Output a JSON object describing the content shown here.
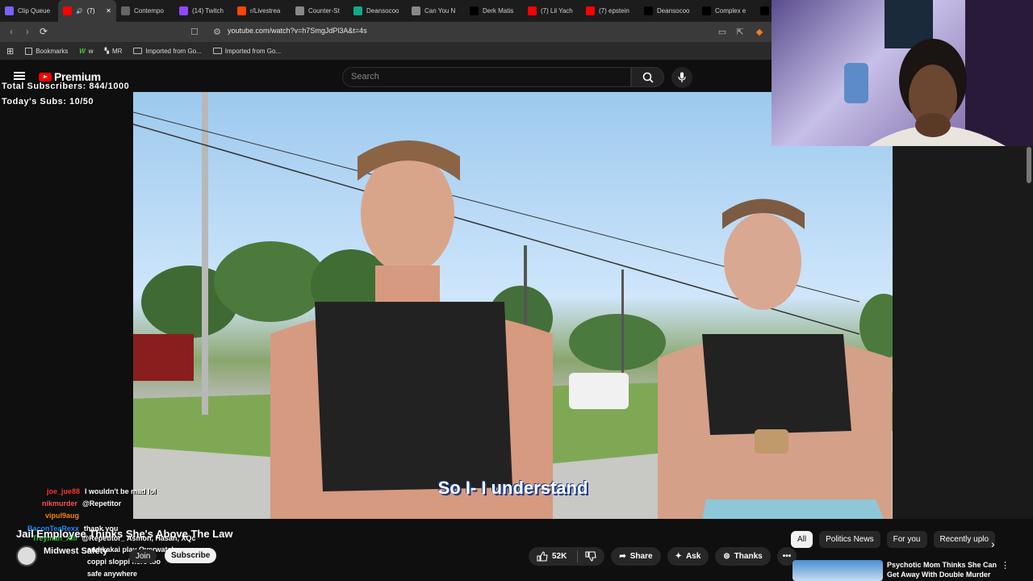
{
  "tabs": [
    {
      "label": "Clip Queue",
      "color": "#7b61ff"
    },
    {
      "label": "(7)",
      "color": "#ff0000",
      "active": true
    },
    {
      "label": "Contempo",
      "color": "#666"
    },
    {
      "label": "(14) Twitch",
      "color": "#9146ff"
    },
    {
      "label": "r/Livestrea",
      "color": "#ff4500"
    },
    {
      "label": "Counter-St",
      "color": "#888"
    },
    {
      "label": "Deansocoo",
      "color": "#1a8"
    },
    {
      "label": "Can You N",
      "color": "#888"
    },
    {
      "label": "Derk Matis",
      "color": "#000"
    },
    {
      "label": "(7) Lil Yach",
      "color": "#ff0000"
    },
    {
      "label": "(7) epstein",
      "color": "#ff0000"
    },
    {
      "label": "Deansocoo",
      "color": "#000"
    },
    {
      "label": "Complex e",
      "color": "#000"
    },
    {
      "label": "Sc",
      "color": "#000"
    }
  ],
  "address": {
    "url": "youtube.com/watch?v=h7SmgJdPl3A&t=4s"
  },
  "bookmarks": [
    {
      "label": "Bookmarks"
    },
    {
      "label": "w"
    },
    {
      "label": "MR"
    },
    {
      "label": "Imported from Go..."
    },
    {
      "label": "Imported from Go..."
    }
  ],
  "youtube": {
    "logo": "Premium",
    "search_placeholder": "Search"
  },
  "overlay": {
    "total_subs": "Total Subscribers: 844/1000",
    "today_subs": "Today's Subs: 10/50"
  },
  "video": {
    "subtitle": "So I- I understand"
  },
  "chat": [
    {
      "user": "joe_jue88",
      "msg": "I wouldn't be mad lol",
      "color": "#ff3b3b"
    },
    {
      "user": "nikmurder",
      "msg": "@Repetitor",
      "color": "#ff5c5c"
    },
    {
      "user": "vipul9aug",
      "msg": "",
      "color": "#ff8c00"
    },
    {
      "user": "BaconTeaRexx",
      "msg": "thank you",
      "color": "#1e90ff"
    },
    {
      "user": "Treyman_Xlll",
      "msg": "@Repetitor_ Asmon, Hasan, XQc",
      "color": "#32cd32"
    },
    {
      "user": "",
      "msg": "and kakai play Overwatch",
      "color": "#ffffff"
    },
    {
      "user": "",
      "msg": "coppi sloppi here too",
      "color": "#ffffff"
    },
    {
      "user": "",
      "msg": "safe anywhere",
      "color": "#ffffff"
    }
  ],
  "video_info": {
    "title": "Jail Employee Thinks She's Above The Law",
    "channel": "Midwest Safety",
    "join": "Join",
    "subscribe": "Subscribe",
    "likes": "52K",
    "share": "Share",
    "ask": "Ask",
    "thanks": "Thanks"
  },
  "chips": [
    "All",
    "Politics News",
    "For you",
    "Recently uplo"
  ],
  "recommendation": {
    "title": "Psychotic Mom Thinks She Can Get Away With Double Murder"
  }
}
